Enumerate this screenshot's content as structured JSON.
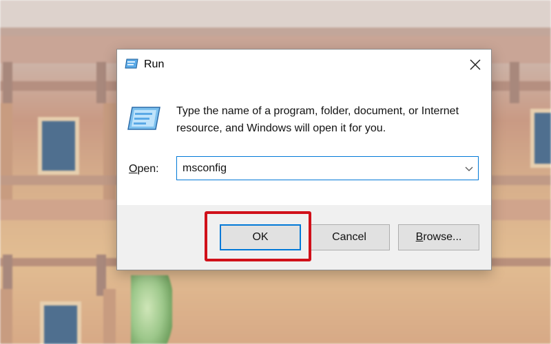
{
  "dialog": {
    "title": "Run",
    "description": "Type the name of a program, folder, document, or Internet resource, and Windows will open it for you.",
    "open_label_first": "O",
    "open_label_rest": "pen:",
    "open_value": "msconfig",
    "buttons": {
      "ok": "OK",
      "cancel": "Cancel",
      "browse_first": "B",
      "browse_rest": "rowse..."
    }
  },
  "colors": {
    "focus_border": "#0078d7",
    "highlight_frame": "#d0101a",
    "footer_bg": "#f0f0f0"
  },
  "icons": {
    "title": "run-icon",
    "close": "close-icon",
    "dialog": "run-icon",
    "dropdown": "chevron-down-icon"
  }
}
